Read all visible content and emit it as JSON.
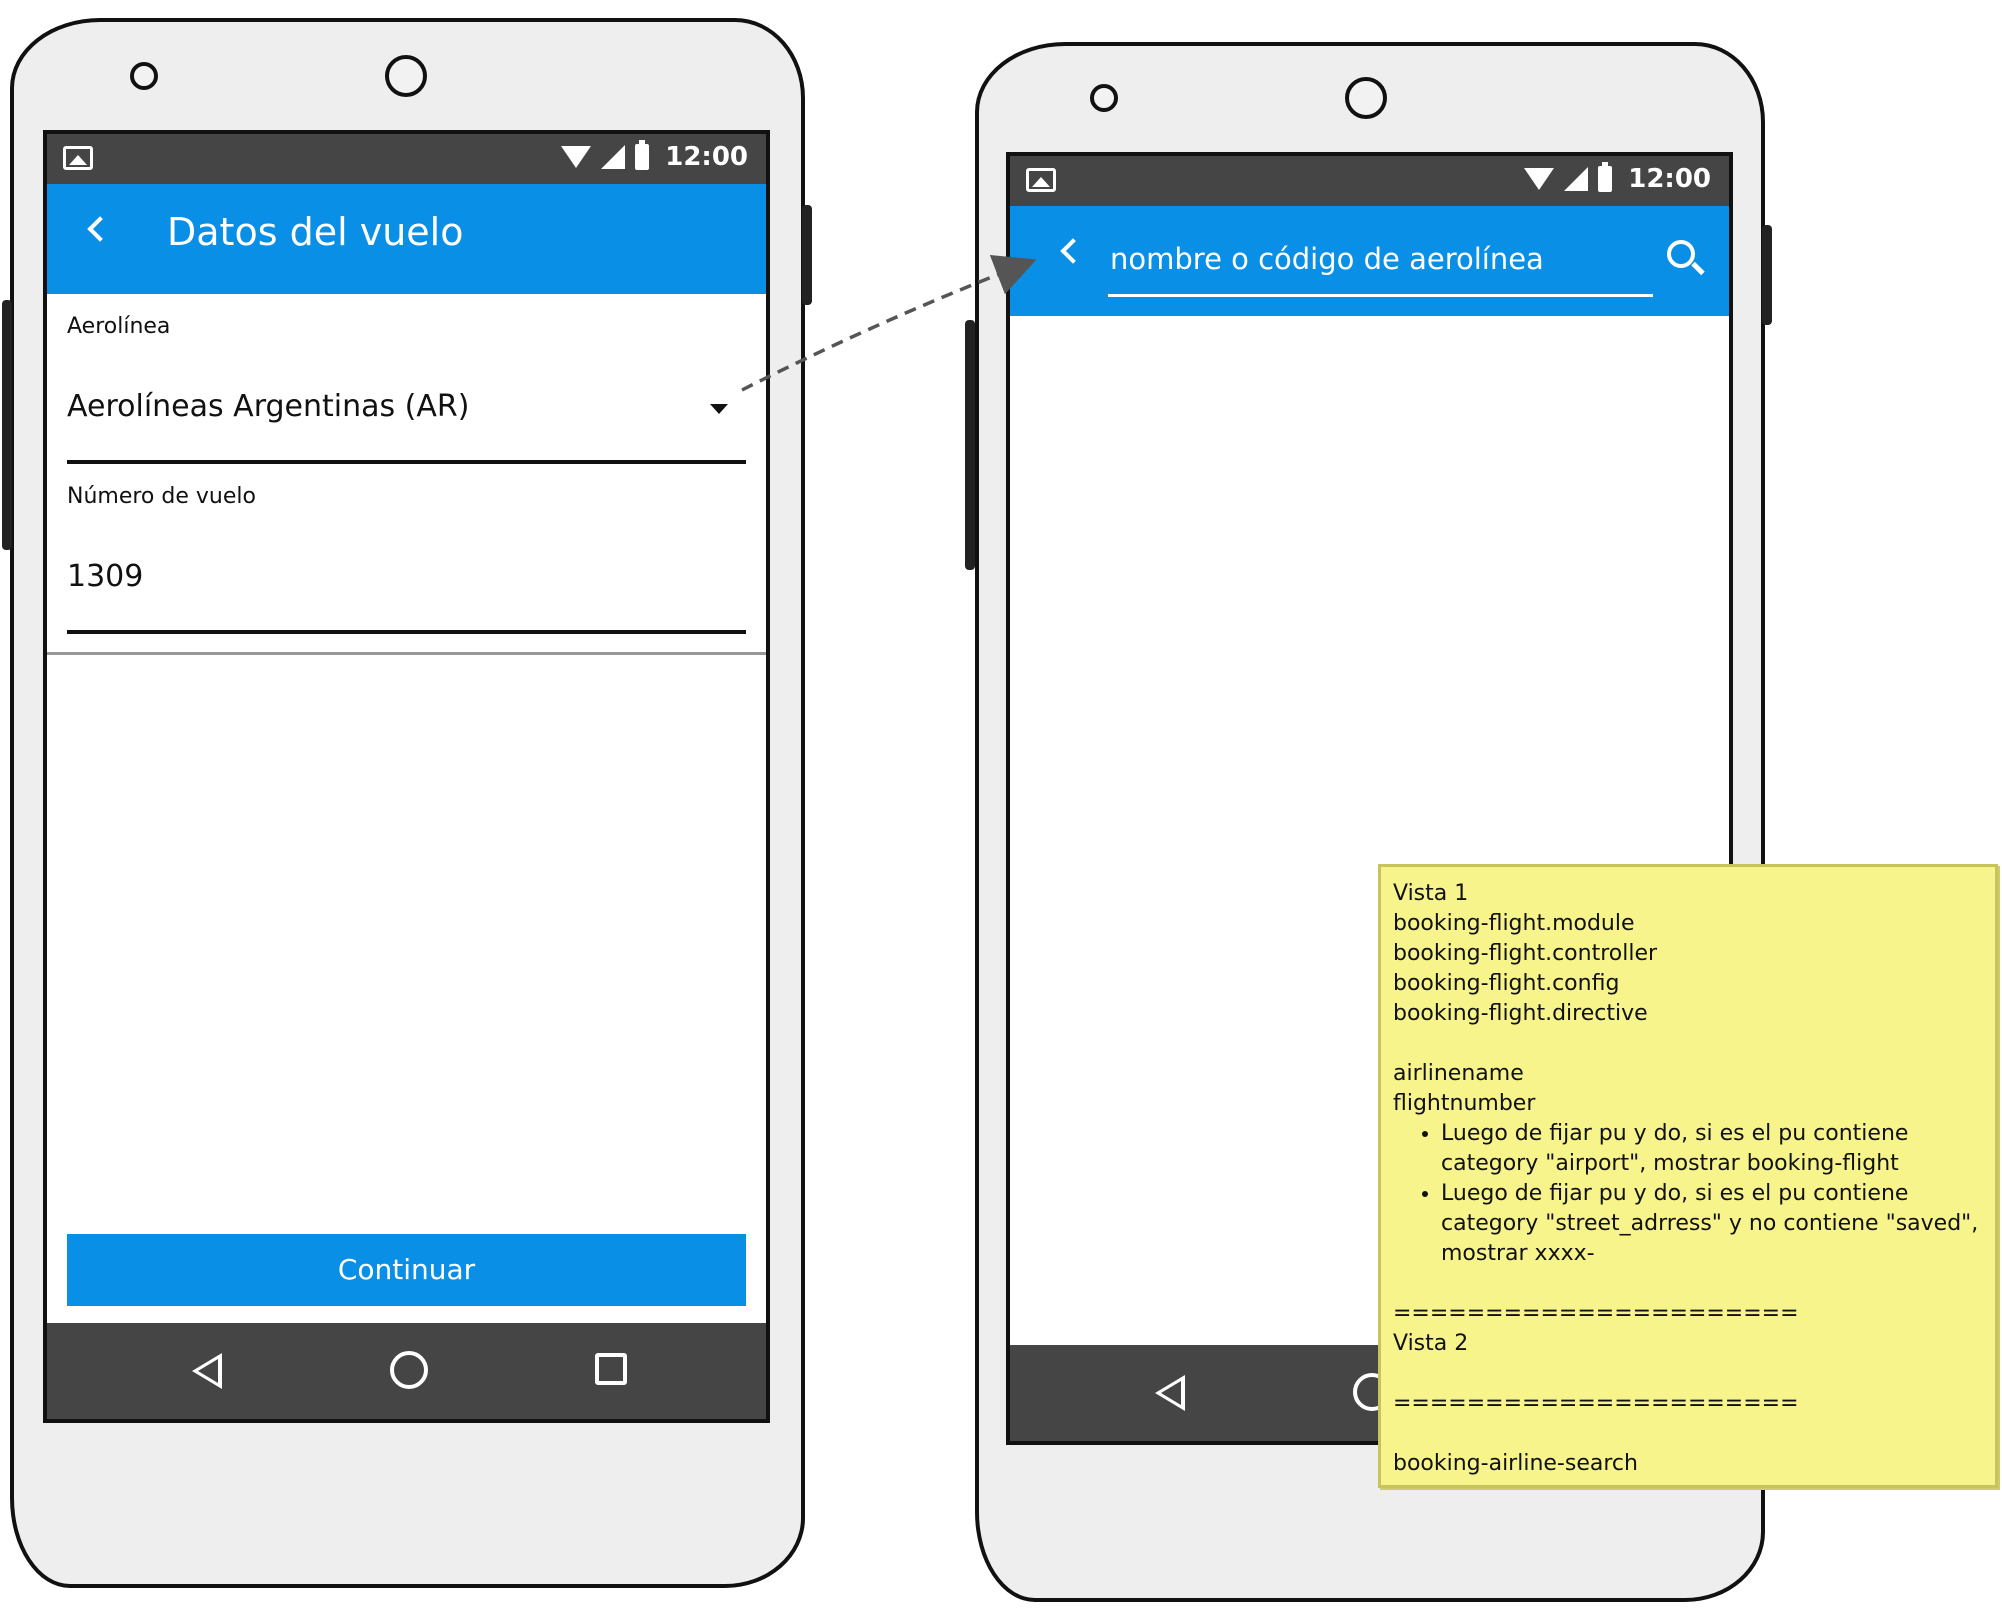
{
  "status_bar": {
    "time": "12:00"
  },
  "screen1": {
    "title": "Datos del vuelo",
    "airline_label": "Aerolínea",
    "airline_value": "Aerolíneas Argentinas (AR)",
    "flight_label": "Número de vuelo",
    "flight_value": "1309",
    "continue_button": "Continuar"
  },
  "screen2": {
    "search_placeholder": "nombre o código de aerolínea"
  },
  "note": {
    "lines_top": [
      "Vista 1",
      "booking-flight.module",
      "booking-flight.controller",
      "booking-flight.config",
      "booking-flight.directive",
      "",
      "airlinename",
      "flightnumber"
    ],
    "bullets": [
      "Luego de fijar pu y do, si es el pu contiene category \"airport\", mostrar booking-flight",
      "Luego de fijar pu y do, si es el pu contiene category \"street_adrress\" y no contiene \"saved\", mostrar xxxx-"
    ],
    "lines_bottom": [
      "",
      "======================",
      "Vista 2",
      "",
      "======================",
      "",
      "booking-airline-search"
    ]
  },
  "colors": {
    "appbar": "#0a8fe6",
    "statusbar": "#454545",
    "note_bg": "#f7f48c",
    "phone_body": "#eeeeee"
  }
}
